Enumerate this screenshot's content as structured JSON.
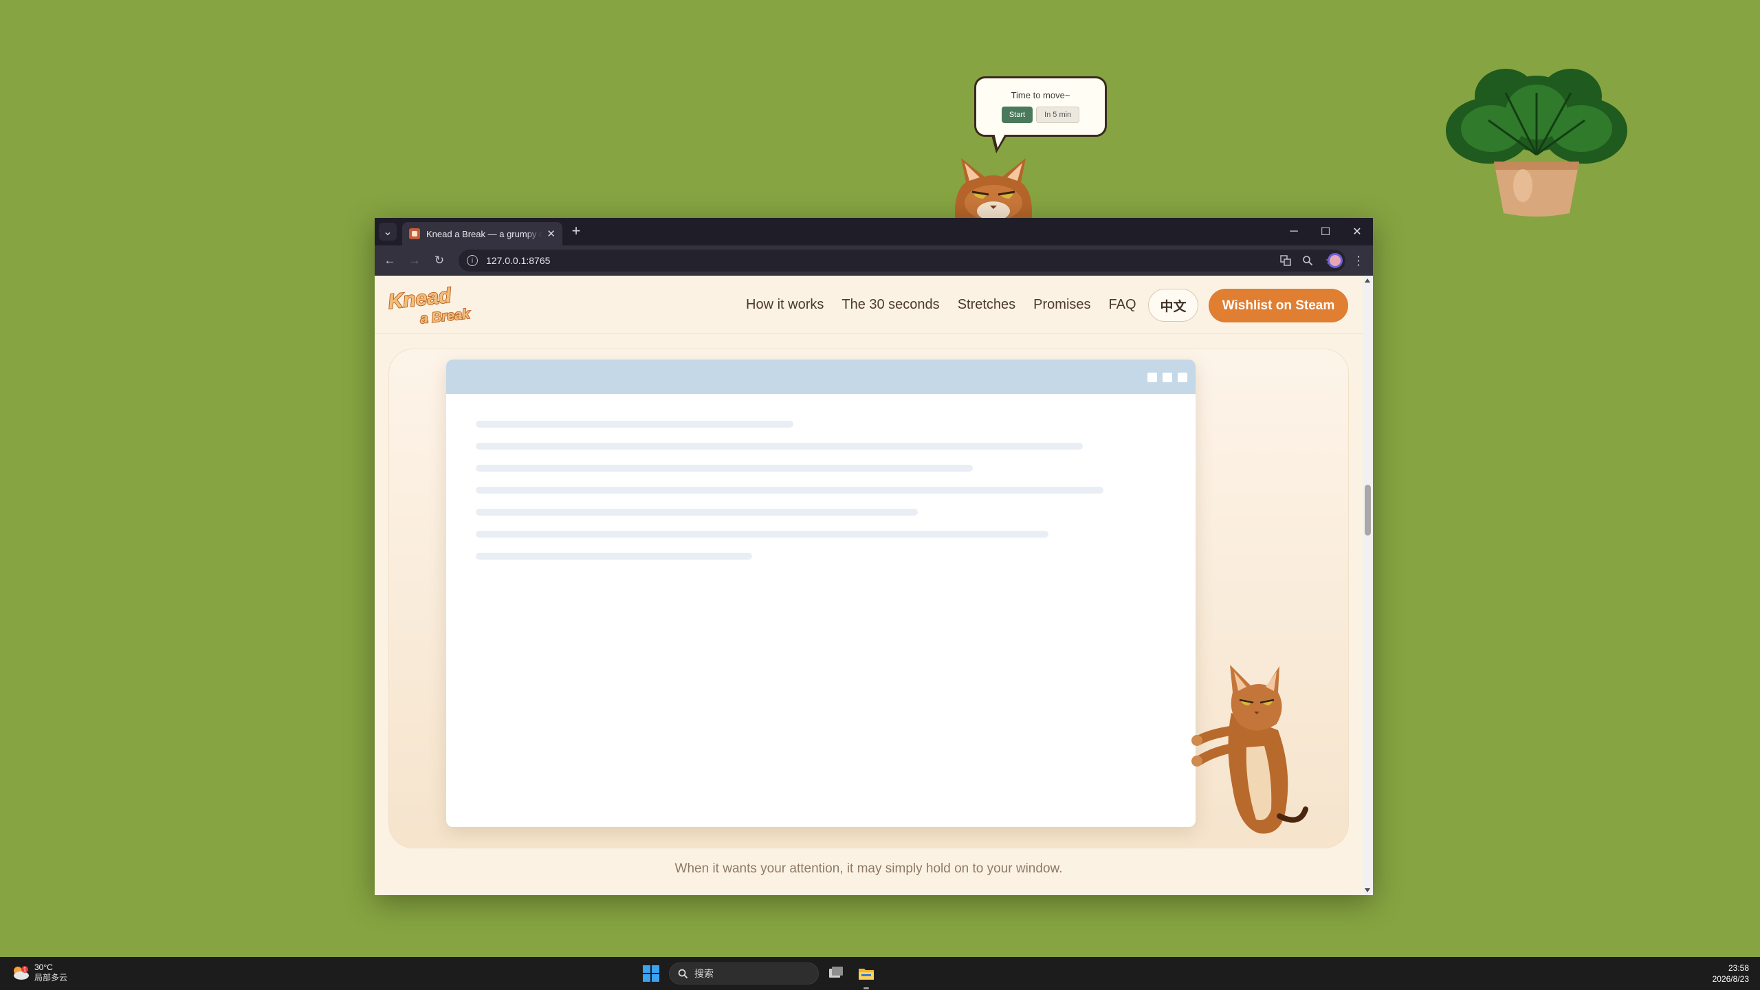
{
  "desktop": {
    "reminder": {
      "message": "Time to move~",
      "start_label": "Start",
      "later_label": "In 5 min"
    }
  },
  "browser": {
    "tab_title": "Knead a Break — a grumpy cat",
    "tab_close": "✕",
    "new_tab": "+",
    "url": "127.0.0.1:8765",
    "controls": {
      "minimize": "─",
      "maximize": "☐",
      "close": "✕"
    }
  },
  "site": {
    "logo_line1": "Knead",
    "logo_line2": "a Break",
    "nav": [
      {
        "label": "How it works"
      },
      {
        "label": "The 30 seconds"
      },
      {
        "label": "Stretches"
      },
      {
        "label": "Promises"
      },
      {
        "label": "FAQ"
      }
    ],
    "language_label": "中文",
    "cta_label": "Wishlist on Steam",
    "caption": "When it wants your attention, it may simply hold on to your window."
  },
  "taskbar": {
    "weather_temp": "30°C",
    "weather_desc": "局部多云",
    "weather_badge": "1",
    "search_label": "搜索",
    "time": "23:58",
    "date": "2026/8/23"
  },
  "colors": {
    "desktop": "#86a441",
    "cta": "#e07e31",
    "page_bg": "#fcf2e4",
    "start_button": "#4a7a5b"
  }
}
